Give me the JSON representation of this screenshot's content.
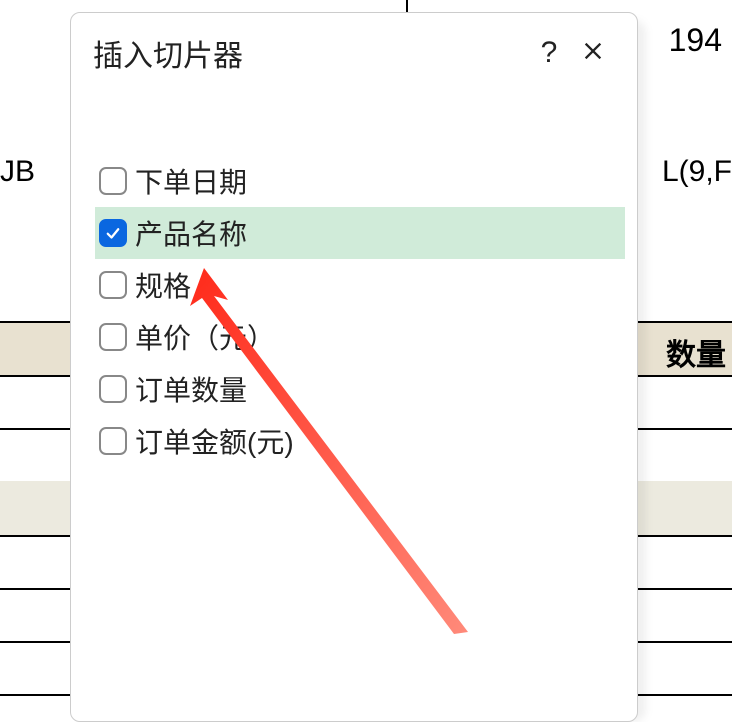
{
  "background": {
    "top_right_number": "194",
    "left_formula_fragment": "JB",
    "right_formula_fragment": "L(9,F",
    "header_label_right": "数量"
  },
  "dialog": {
    "title": "插入切片器",
    "help_label": "?",
    "fields": [
      {
        "label": "下单日期",
        "checked": false
      },
      {
        "label": "产品名称",
        "checked": true
      },
      {
        "label": "规格",
        "checked": false
      },
      {
        "label": "单价（元）",
        "checked": false
      },
      {
        "label": "订单数量",
        "checked": false
      },
      {
        "label": "订单金额(元)",
        "checked": false
      }
    ]
  }
}
